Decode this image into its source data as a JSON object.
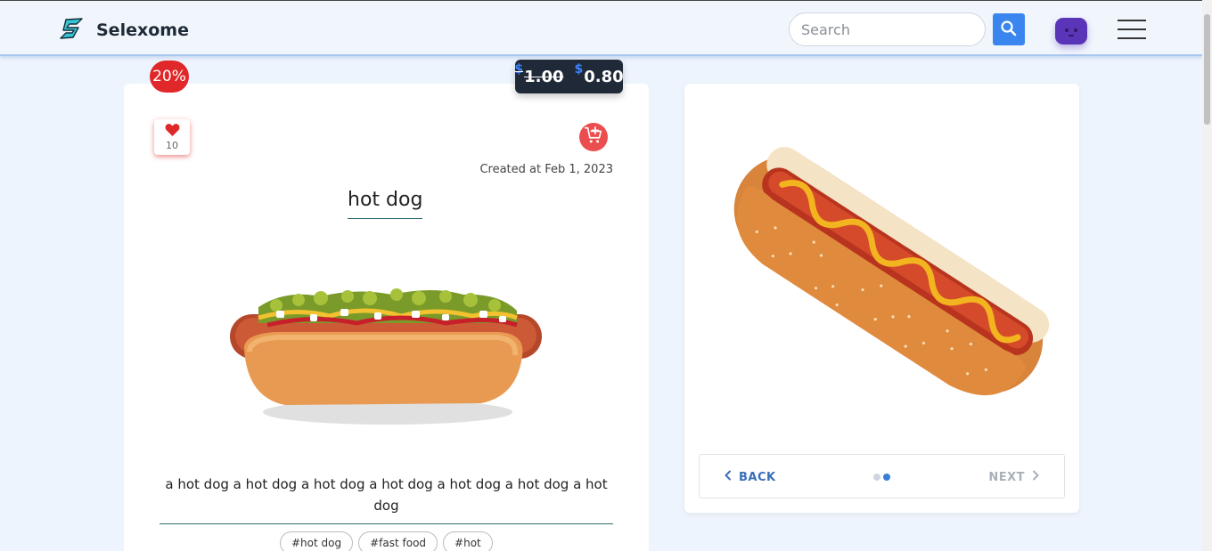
{
  "header": {
    "brand_name": "Selexome",
    "search_placeholder": "Search",
    "icons": [
      "logo-icon",
      "search-icon",
      "avatar",
      "hamburger-menu-icon"
    ],
    "accent_color": "#3a86ee"
  },
  "product": {
    "discount": "20%",
    "price": {
      "currency_old": "$",
      "old": "1.00",
      "currency_new": "$",
      "new": "0.80"
    },
    "likes": "10",
    "created": "Created at Feb 1, 2023",
    "title": "hot dog",
    "description": "a hot dog a hot dog a hot dog a hot dog a hot dog a hot dog a hot dog",
    "tags": [
      "#hot dog",
      "#fast food",
      "#hot"
    ]
  },
  "carousel": {
    "back_label": "BACK",
    "next_label": "NEXT",
    "slide_count": 2,
    "active_slide": 2
  },
  "colors": {
    "discount_red": "#e0282a",
    "price_dark": "#1f2937",
    "brand_blue": "#3a86ee"
  }
}
